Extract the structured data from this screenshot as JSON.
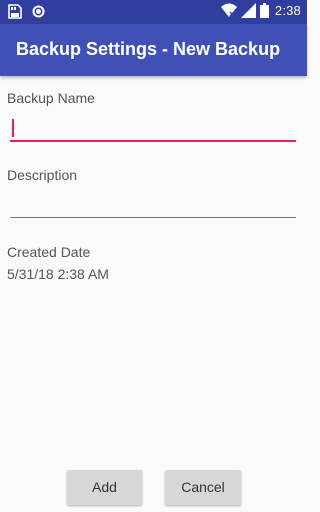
{
  "status_bar": {
    "time": "2:38",
    "icons": [
      "sd-card-icon",
      "circle-icon",
      "wifi-icon",
      "signal-icon",
      "battery-icon"
    ]
  },
  "app_bar": {
    "title": "Backup Settings - New Backup",
    "color": "#3f51b5",
    "status_color": "#303f9f"
  },
  "form": {
    "backup_name": {
      "label": "Backup Name",
      "value": "",
      "accent": "#e91e63"
    },
    "description": {
      "label": "Description",
      "value": ""
    },
    "created_date": {
      "label": "Created Date",
      "value": "5/31/18 2:38 AM"
    }
  },
  "buttons": {
    "add": "Add",
    "cancel": "Cancel"
  }
}
